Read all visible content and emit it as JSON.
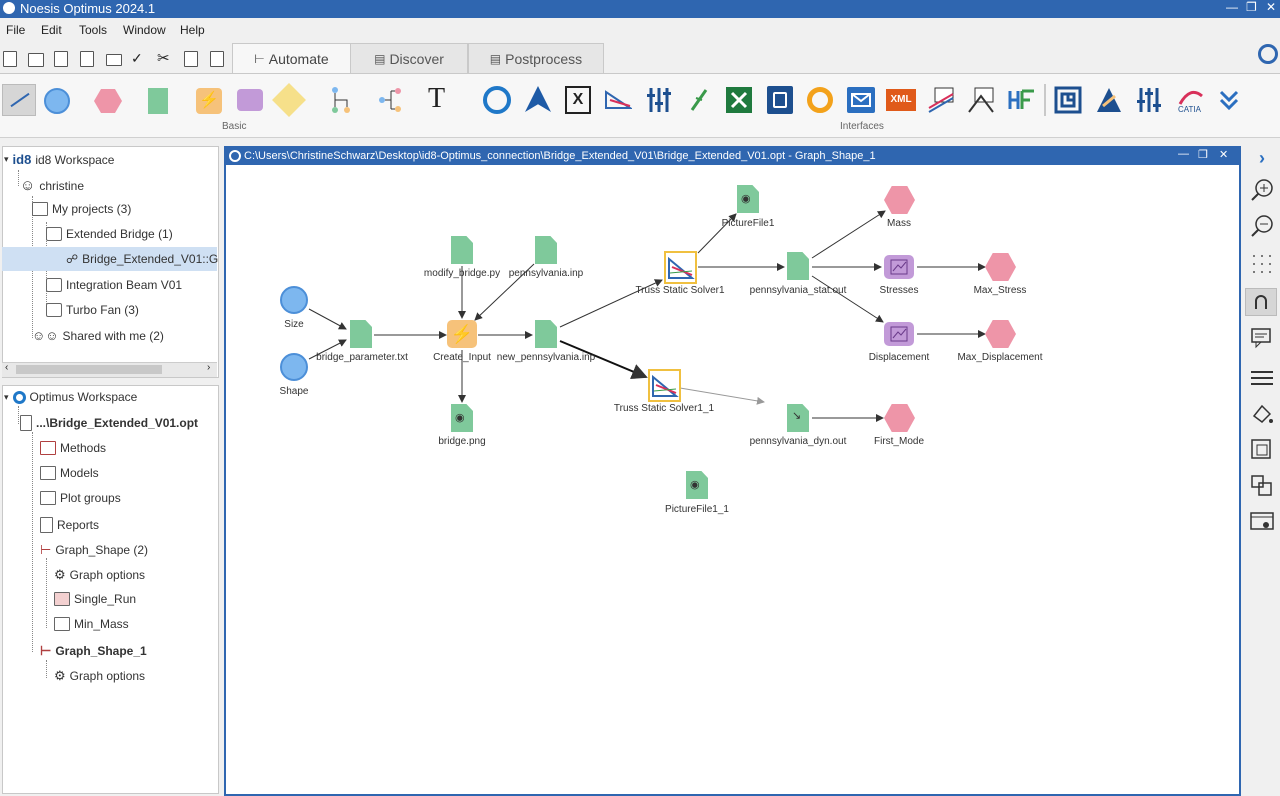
{
  "app": {
    "title": "Noesis Optimus 2024.1"
  },
  "menu": [
    "File",
    "Edit",
    "Tools",
    "Window",
    "Help"
  ],
  "tabs": [
    {
      "label": "Automate",
      "icon": "automate-icon",
      "active": true
    },
    {
      "label": "Discover",
      "icon": "discover-icon",
      "active": false
    },
    {
      "label": "Postprocess",
      "icon": "postprocess-icon",
      "active": false
    }
  ],
  "ribbon": {
    "group_basic": "Basic",
    "group_interfaces": "Interfaces",
    "xml_label": "XML",
    "text_tool": "T"
  },
  "workspace_tree": {
    "root": "id8 Workspace",
    "logo": "id8",
    "items": [
      {
        "label": "christine"
      },
      {
        "label": "My projects (3)"
      },
      {
        "label": "Extended Bridge (1)"
      },
      {
        "label": "Bridge_Extended_V01::G"
      },
      {
        "label": "Integration Beam V01"
      },
      {
        "label": "Turbo Fan (3)"
      },
      {
        "label": "Shared with me (2)"
      }
    ]
  },
  "optimus_tree": {
    "root": "Optimus Workspace",
    "items": [
      {
        "label": "...\\Bridge_Extended_V01.opt"
      },
      {
        "label": "Methods"
      },
      {
        "label": "Models"
      },
      {
        "label": "Plot groups"
      },
      {
        "label": "Reports"
      },
      {
        "label": "Graph_Shape (2)"
      },
      {
        "label": "Graph options"
      },
      {
        "label": "Single_Run"
      },
      {
        "label": "Min_Mass"
      },
      {
        "label": "Graph_Shape_1"
      },
      {
        "label": "Graph options"
      }
    ]
  },
  "graph_window": {
    "title": "C:\\Users\\ChristineSchwarz\\Desktop\\id8-Optimus_connection\\Bridge_Extended_V01\\Bridge_Extended_V01.opt - Graph_Shape_1",
    "nodes": [
      {
        "id": "size",
        "label": "Size"
      },
      {
        "id": "shape",
        "label": "Shape"
      },
      {
        "id": "bridge_parameter",
        "label": "bridge_parameter.txt"
      },
      {
        "id": "modify_bridge",
        "label": "modify_bridge.py"
      },
      {
        "id": "pennsylvania_inp",
        "label": "pennsylvania.inp"
      },
      {
        "id": "create_input",
        "label": "Create_Input"
      },
      {
        "id": "new_pennsylvania",
        "label": "new_pennsylvania.inp"
      },
      {
        "id": "bridge_png",
        "label": "bridge.png"
      },
      {
        "id": "truss1",
        "label": "Truss Static Solver1"
      },
      {
        "id": "truss1_1",
        "label": "Truss Static Solver1_1"
      },
      {
        "id": "picturefile1",
        "label": "PictureFile1"
      },
      {
        "id": "picturefile1_1",
        "label": "PictureFile1_1"
      },
      {
        "id": "stat_out",
        "label": "pennsylvania_stat.out"
      },
      {
        "id": "dyn_out",
        "label": "pennsylvania_dyn.out"
      },
      {
        "id": "mass",
        "label": "Mass"
      },
      {
        "id": "stresses",
        "label": "Stresses"
      },
      {
        "id": "displacement",
        "label": "Displacement"
      },
      {
        "id": "max_stress",
        "label": "Max_Stress"
      },
      {
        "id": "max_displacement",
        "label": "Max_Displacement"
      },
      {
        "id": "first_mode",
        "label": "First_Mode"
      }
    ]
  },
  "colors": {
    "titlebar": "#2f66b0",
    "doc_green": "#7fc99b",
    "response_pink": "#ee95a8",
    "input_blue": "#7db7ef",
    "function_purple": "#c29ad8",
    "action_orange": "#f6c27a"
  }
}
